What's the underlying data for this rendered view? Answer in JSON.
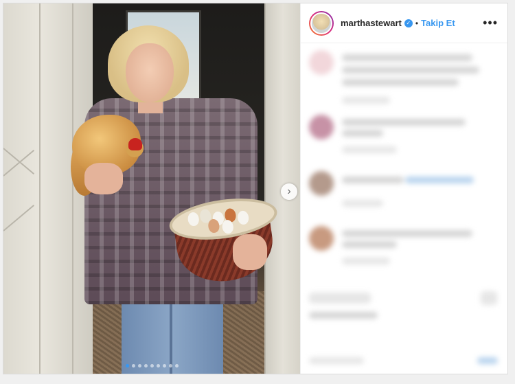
{
  "post": {
    "username": "marthastewart",
    "verified": "✓",
    "separator": "•",
    "follow_label": "Takip Et",
    "more_label": "•••",
    "carousel_next": "›",
    "carousel_dots": 9,
    "active_dot": 0
  },
  "colors": {
    "accent": "#3897f0",
    "text": "#262626",
    "border": "#dbdbdb"
  },
  "icons": {
    "verified": "verified-badge-icon",
    "next": "chevron-right-icon",
    "more": "more-options-icon"
  }
}
